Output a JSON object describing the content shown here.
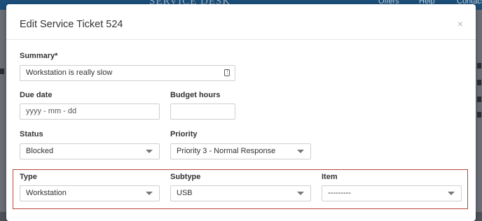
{
  "background": {
    "app_title": "SERVICE DESK",
    "nav": [
      "Offers",
      "Help",
      "Contact"
    ]
  },
  "modal": {
    "title": "Edit Service Ticket 524",
    "close_glyph": "×"
  },
  "form": {
    "summary": {
      "label": "Summary*",
      "value": "Workstation is really slow"
    },
    "due_date": {
      "label": "Due date",
      "placeholder": "yyyy - mm - dd"
    },
    "budget_hours": {
      "label": "Budget hours",
      "value": ""
    },
    "status": {
      "label": "Status",
      "value": "Blocked"
    },
    "priority": {
      "label": "Priority",
      "value": "Priority 3 - Normal Response"
    },
    "type": {
      "label": "Type",
      "value": "Workstation"
    },
    "subtype": {
      "label": "Subtype",
      "value": "USB"
    },
    "item": {
      "label": "Item",
      "value": "---------"
    }
  },
  "colors": {
    "highlight_border": "#b5473a",
    "header_bg": "#1c4f7a"
  }
}
